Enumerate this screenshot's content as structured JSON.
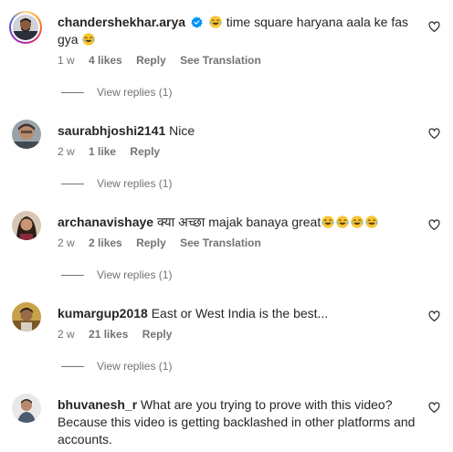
{
  "comments": [
    {
      "username": "chandershekhar.arya",
      "text": "time square haryana aala ke fas gya",
      "time": "1 w",
      "likes": "4 likes",
      "reply": "Reply",
      "translate": "See Translation",
      "view_replies": "View replies (1)"
    },
    {
      "username": "saurabhjoshi2141",
      "text": "Nice",
      "time": "2 w",
      "likes": "1 like",
      "reply": "Reply",
      "view_replies": "View replies (1)"
    },
    {
      "username": "archanavishaye",
      "text": "क्या अच्छा majak banaya great",
      "time": "2 w",
      "likes": "2 likes",
      "reply": "Reply",
      "translate": "See Translation",
      "view_replies": "View replies (1)"
    },
    {
      "username": "kumargup2018",
      "text": "East or West India is the best...",
      "time": "2 w",
      "likes": "21 likes",
      "reply": "Reply",
      "view_replies": "View replies (1)"
    },
    {
      "username": "bhuvanesh_r",
      "text": "What are you trying to prove with this video? Because this video is getting backlashed in other platforms and accounts."
    }
  ],
  "colors": {
    "text": "#262626",
    "secondary": "#737373",
    "verified": "#0095f6",
    "emoji": "#f7c633"
  },
  "icons": {
    "heart": "heart-outline-icon",
    "verified": "verified-badge-icon",
    "emoji": "face-with-tears-of-joy-icon"
  }
}
